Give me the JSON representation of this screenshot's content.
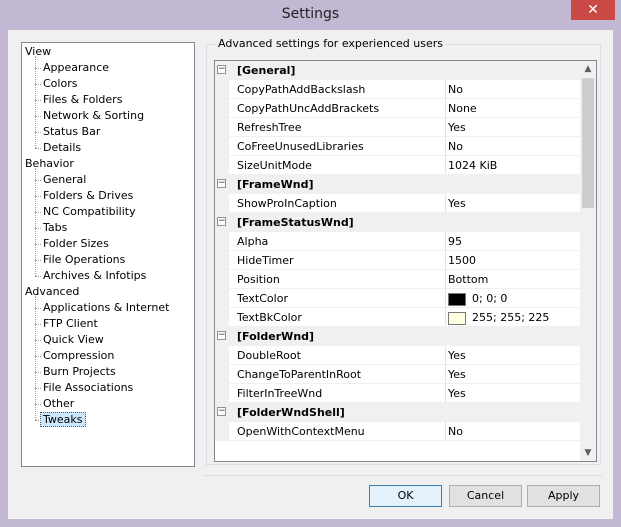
{
  "window": {
    "title": "Settings",
    "close_glyph": "✕",
    "background_color": "#c2b8d3",
    "close_button_color": "#c94a45"
  },
  "tree": {
    "categories": [
      {
        "label": "View",
        "items": [
          "Appearance",
          "Colors",
          "Files & Folders",
          "Network & Sorting",
          "Status Bar",
          "Details"
        ]
      },
      {
        "label": "Behavior",
        "items": [
          "General",
          "Folders & Drives",
          "NC Compatibility",
          "Tabs",
          "Folder Sizes",
          "File Operations",
          "Archives & Infotips"
        ]
      },
      {
        "label": "Advanced",
        "items": [
          "Applications & Internet",
          "FTP Client",
          "Quick View",
          "Compression",
          "Burn Projects",
          "File Associations",
          "Other",
          "Tweaks"
        ]
      }
    ],
    "selected": "Tweaks"
  },
  "group": {
    "label": "Advanced settings for experienced users"
  },
  "grid": {
    "rows": [
      {
        "type": "cat",
        "name": "[General]",
        "toggle": "−"
      },
      {
        "type": "prop",
        "name": "CopyPathAddBackslash",
        "value": "No"
      },
      {
        "type": "prop",
        "name": "CopyPathUncAddBrackets",
        "value": "None"
      },
      {
        "type": "prop",
        "name": "RefreshTree",
        "value": "Yes"
      },
      {
        "type": "prop",
        "name": "CoFreeUnusedLibraries",
        "value": "No"
      },
      {
        "type": "prop",
        "name": "SizeUnitMode",
        "value": "1024 KiB"
      },
      {
        "type": "cat",
        "name": "[FrameWnd]",
        "toggle": "−"
      },
      {
        "type": "prop",
        "name": "ShowProInCaption",
        "value": "Yes"
      },
      {
        "type": "cat",
        "name": "[FrameStatusWnd]",
        "toggle": "−"
      },
      {
        "type": "prop",
        "name": "Alpha",
        "value": "95"
      },
      {
        "type": "prop",
        "name": "HideTimer",
        "value": "1500"
      },
      {
        "type": "prop",
        "name": "Position",
        "value": "Bottom"
      },
      {
        "type": "prop",
        "name": "TextColor",
        "value": "0; 0; 0",
        "swatch": "#000000"
      },
      {
        "type": "prop",
        "name": "TextBkColor",
        "value": "255; 255; 225",
        "swatch": "#ffffe1"
      },
      {
        "type": "cat",
        "name": "[FolderWnd]",
        "toggle": "−"
      },
      {
        "type": "prop",
        "name": "DoubleRoot",
        "value": "Yes"
      },
      {
        "type": "prop",
        "name": "ChangeToParentInRoot",
        "value": "Yes"
      },
      {
        "type": "prop",
        "name": "FilterInTreeWnd",
        "value": "Yes"
      },
      {
        "type": "cat",
        "name": "[FolderWndShell]",
        "toggle": "−"
      },
      {
        "type": "prop",
        "name": "OpenWithContextMenu",
        "value": "No"
      }
    ],
    "scroll_up_glyph": "▲",
    "scroll_down_glyph": "▼"
  },
  "buttons": {
    "ok": "OK",
    "cancel": "Cancel",
    "apply": "Apply"
  }
}
